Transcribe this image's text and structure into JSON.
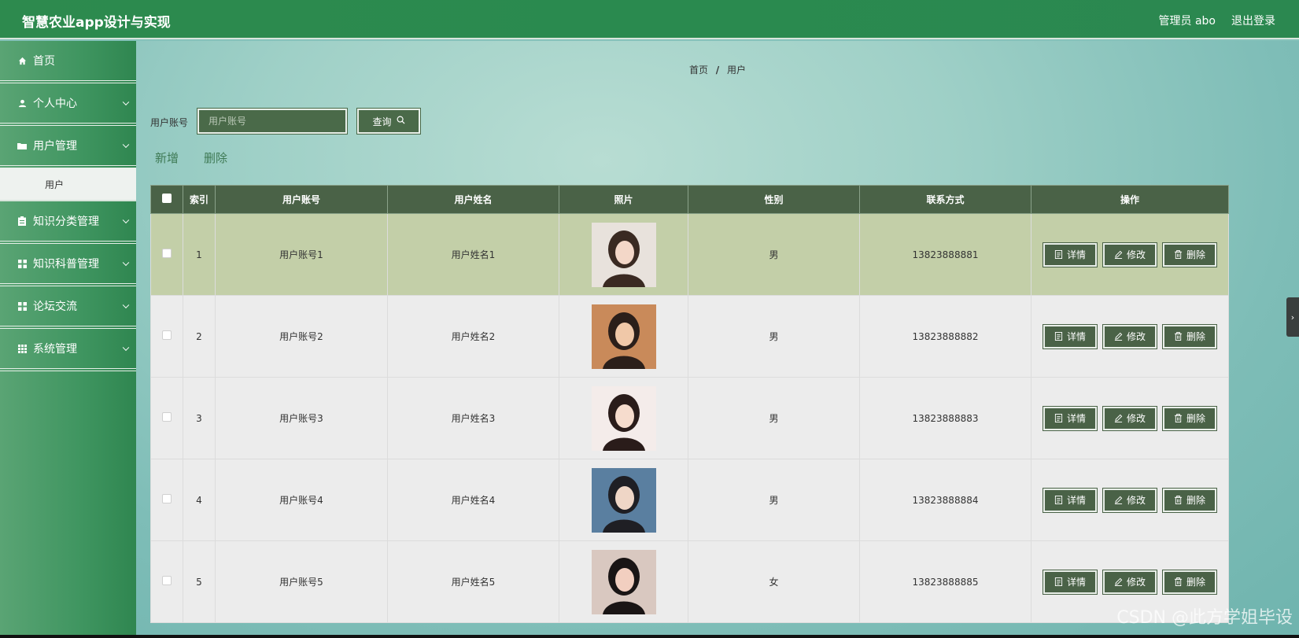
{
  "app": {
    "title": "智慧农业app设计与实现"
  },
  "topbar": {
    "user": "管理员 abo",
    "logout": "退出登录"
  },
  "sidebar": {
    "items": [
      {
        "label": "首页",
        "icon": "home-icon",
        "expandable": false
      },
      {
        "label": "个人中心",
        "icon": "user-icon",
        "expandable": true
      },
      {
        "label": "用户管理",
        "icon": "folder-icon",
        "expandable": true
      },
      {
        "label": "知识分类管理",
        "icon": "clipboard-icon",
        "expandable": true
      },
      {
        "label": "知识科普管理",
        "icon": "grid-icon",
        "expandable": true
      },
      {
        "label": "论坛交流",
        "icon": "grid-icon",
        "expandable": true
      },
      {
        "label": "系统管理",
        "icon": "apps-icon",
        "expandable": true
      }
    ],
    "submenu": {
      "label": "用户"
    }
  },
  "breadcrumb": {
    "home": "首页",
    "sep": "/",
    "current": "用户"
  },
  "search": {
    "label": "用户账号",
    "placeholder": "用户账号",
    "button": "查询"
  },
  "actions": {
    "add": "新增",
    "delete": "删除"
  },
  "table": {
    "headers": [
      "索引",
      "用户账号",
      "用户姓名",
      "照片",
      "性别",
      "联系方式",
      "操作"
    ],
    "rows": [
      {
        "index": "1",
        "account": "用户账号1",
        "name": "用户姓名1",
        "gender": "男",
        "phone": "13823888881",
        "highlight": true
      },
      {
        "index": "2",
        "account": "用户账号2",
        "name": "用户姓名2",
        "gender": "男",
        "phone": "13823888882",
        "highlight": false
      },
      {
        "index": "3",
        "account": "用户账号3",
        "name": "用户姓名3",
        "gender": "男",
        "phone": "13823888883",
        "highlight": false
      },
      {
        "index": "4",
        "account": "用户账号4",
        "name": "用户姓名4",
        "gender": "男",
        "phone": "13823888884",
        "highlight": false
      },
      {
        "index": "5",
        "account": "用户账号5",
        "name": "用户姓名5",
        "gender": "女",
        "phone": "13823888885",
        "highlight": false
      }
    ],
    "op_labels": {
      "detail": "详情",
      "edit": "修改",
      "delete": "删除"
    }
  },
  "watermark": "CSDN @此方学姐毕设",
  "colors": {
    "topbar": "#2d8a4e",
    "header": "#4a6247",
    "highlight_row": "#c3cfa8",
    "button": "#4a6247"
  }
}
